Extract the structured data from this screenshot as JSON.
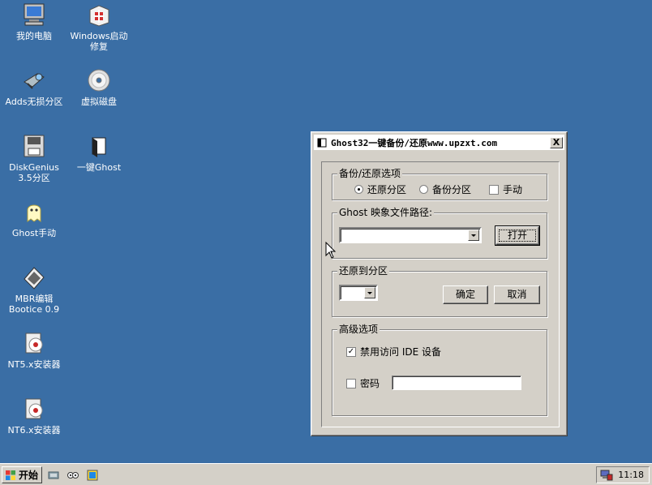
{
  "desktop": {
    "icons": [
      {
        "label": "我的电脑",
        "icon": "my-computer-icon"
      },
      {
        "label": "Windows启动\n修复",
        "icon": "repair-kit-icon"
      },
      {
        "label": "Adds无损分区",
        "icon": "partition-tool-icon"
      },
      {
        "label": "虚拟磁盘",
        "icon": "cd-disc-icon"
      },
      {
        "label": "DiskGenius\n3.5分区",
        "icon": "diskgenius-icon"
      },
      {
        "label": "一键Ghost",
        "icon": "ghost-doc-icon"
      },
      {
        "label": "Ghost手动",
        "icon": "ghost-icon"
      },
      {
        "label": "MBR编辑\nBootice 0.9",
        "icon": "bootice-icon"
      },
      {
        "label": "NT5.x安装器",
        "icon": "installer-icon"
      },
      {
        "label": "NT6.x安装器",
        "icon": "installer-icon"
      }
    ]
  },
  "dialog": {
    "title": "Ghost32一键备份/还原www.upzxt.com",
    "close_label": "X",
    "backup_group": {
      "legend": "备份/还原选项",
      "options": [
        {
          "label": "还原分区",
          "selected": true
        },
        {
          "label": "备份分区",
          "selected": false
        }
      ],
      "manual_label": "手动",
      "manual_checked": false
    },
    "path_group": {
      "legend": "Ghost 映象文件路径:",
      "path_value": "",
      "open_label": "打开"
    },
    "restore_group": {
      "legend": "还原到分区",
      "partition_value": "",
      "ok_label": "确定",
      "cancel_label": "取消"
    },
    "advanced_group": {
      "legend": "高级选项",
      "disable_ide_label": "禁用访问 IDE 设备",
      "disable_ide_checked": true,
      "password_label": "密码",
      "password_checked": false,
      "password_value": ""
    }
  },
  "taskbar": {
    "start_label": "开始",
    "clock": "11:18"
  },
  "colors": {
    "desktop": "#3a6ea5",
    "face": "#d4d0c8"
  }
}
